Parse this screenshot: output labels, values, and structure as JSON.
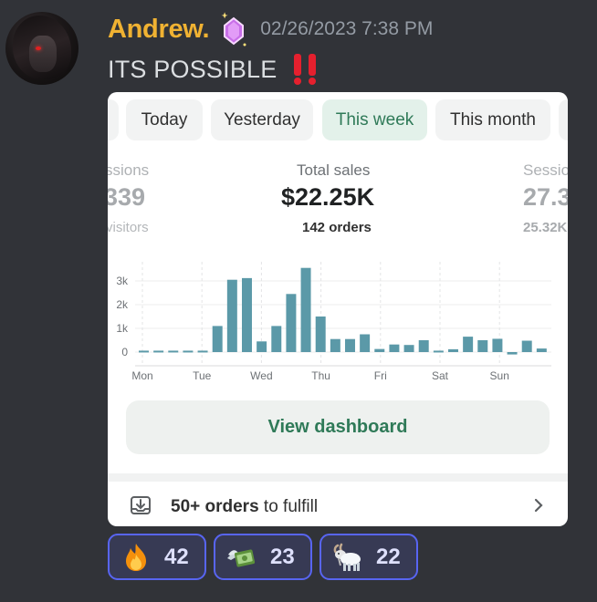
{
  "author": {
    "name": "Andrew.",
    "timestamp": "02/26/2023 7:38 PM"
  },
  "message": {
    "text": "ITS POSSIBLE",
    "emoji": "bangbang"
  },
  "embed": {
    "tabs": [
      {
        "label": "Today",
        "active": false
      },
      {
        "label": "Yesterday",
        "active": false
      },
      {
        "label": "This week",
        "active": true
      },
      {
        "label": "This month",
        "active": false
      }
    ],
    "metrics": {
      "left": {
        "label": "ssions",
        "value": "339",
        "sub": "visitors"
      },
      "center": {
        "label": "Total sales",
        "value": "$22.25K",
        "sub": "142 orders"
      },
      "right": {
        "label": "Sessio",
        "value": "27.3",
        "sub": "25.32K"
      }
    },
    "view_dashboard_label": "View dashboard",
    "fulfill": {
      "count": "50+ orders",
      "rest": " to fulfill"
    }
  },
  "chart_data": {
    "type": "bar",
    "x_labels": [
      "Mon",
      "Tue",
      "Wed",
      "Thu",
      "Fri",
      "Sat",
      "Sun"
    ],
    "y_ticks": [
      "3k",
      "2k",
      "1k",
      "0"
    ],
    "ylim": [
      -200,
      3600
    ],
    "values": [
      60,
      60,
      60,
      60,
      60,
      1100,
      3050,
      3120,
      450,
      1100,
      2450,
      3550,
      1500,
      550,
      550,
      750,
      130,
      320,
      300,
      500,
      60,
      120,
      650,
      500,
      560,
      -100,
      480,
      150
    ],
    "bar_color": "#5b99a8"
  },
  "reactions": [
    {
      "emoji": "fire",
      "count": "42"
    },
    {
      "emoji": "money-with-wings",
      "count": "23"
    },
    {
      "emoji": "goat",
      "count": "22"
    }
  ],
  "colors": {
    "username": "#f0b232",
    "accent_green": "#2f7a58",
    "reaction_border": "#5865f2"
  }
}
